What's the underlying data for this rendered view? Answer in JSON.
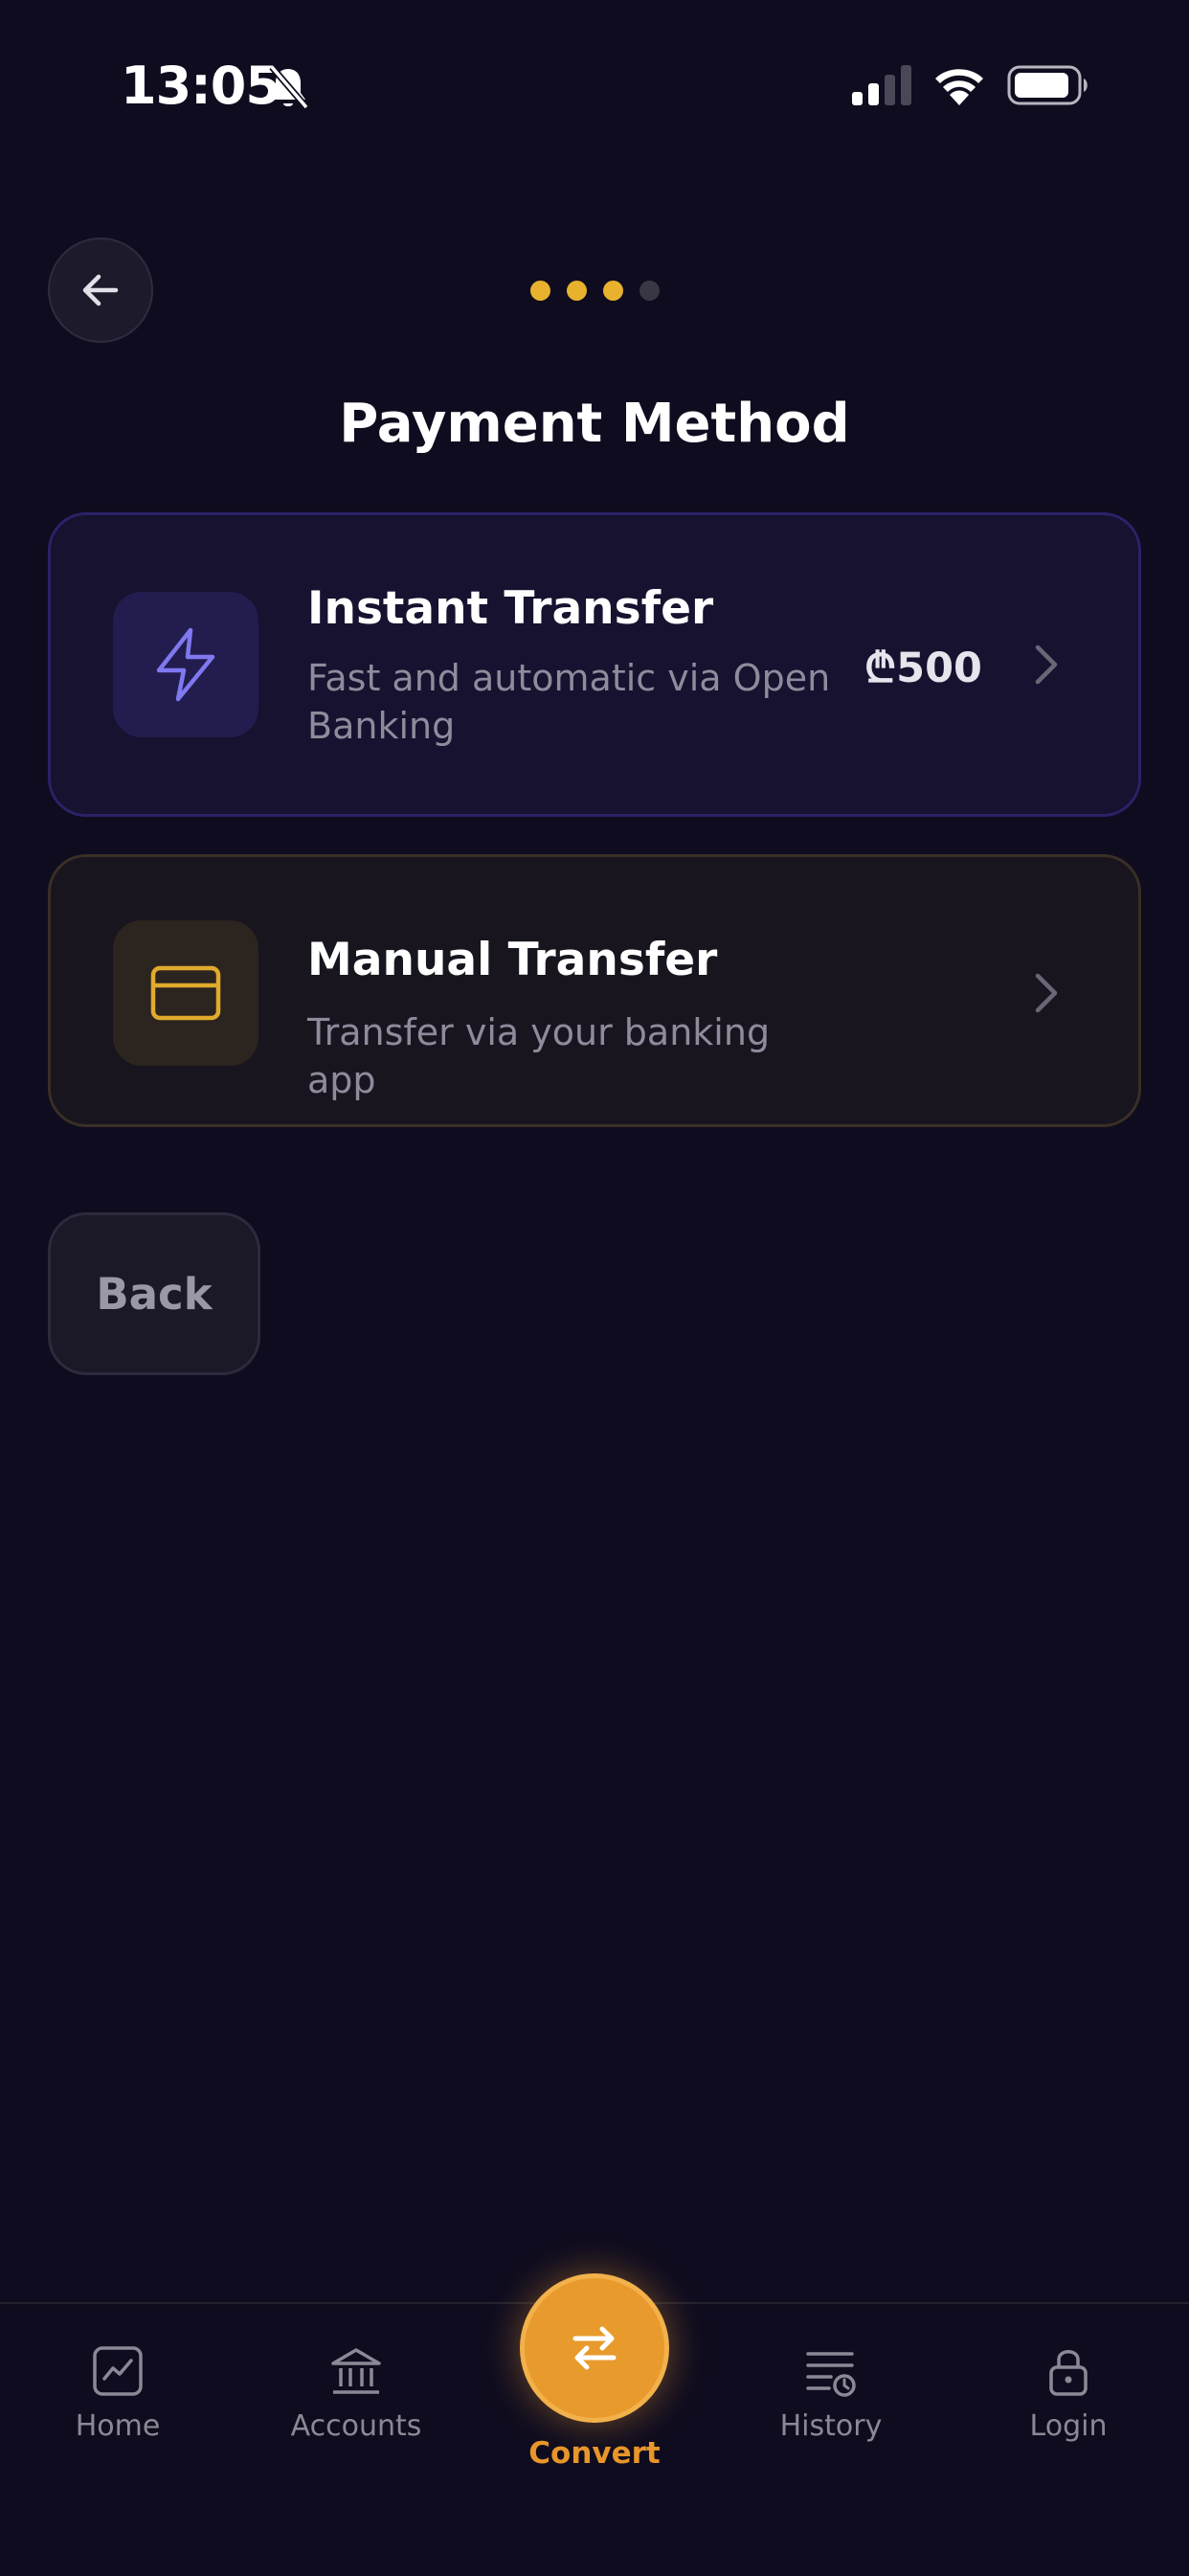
{
  "status_bar": {
    "time": "13:05"
  },
  "progress": {
    "total_steps": 4,
    "current_step": 3
  },
  "header": {
    "title": "Payment Method"
  },
  "options": [
    {
      "title": "Instant Transfer",
      "description": "Fast and automatic via Open Banking",
      "amount": "₾500",
      "icon": "lightning-icon"
    },
    {
      "title": "Manual Transfer",
      "description": "Transfer via your banking app",
      "icon": "credit-card-icon"
    }
  ],
  "back_button": {
    "label": "Back"
  },
  "tab_bar": {
    "items": [
      {
        "label": "Home",
        "icon": "chart-icon"
      },
      {
        "label": "Accounts",
        "icon": "bank-icon"
      },
      {
        "label": "Convert",
        "icon": "swap-arrows-icon",
        "active": true
      },
      {
        "label": "History",
        "icon": "history-list-icon"
      },
      {
        "label": "Login",
        "icon": "lock-icon"
      }
    ]
  },
  "colors": {
    "background": "#0f0c1f",
    "accent": "#e89a2c",
    "progress_active": "#e8b22e",
    "progress_inactive": "#3a3745",
    "instant_icon": "#7f78f0",
    "manual_icon": "#e0ab2c"
  }
}
